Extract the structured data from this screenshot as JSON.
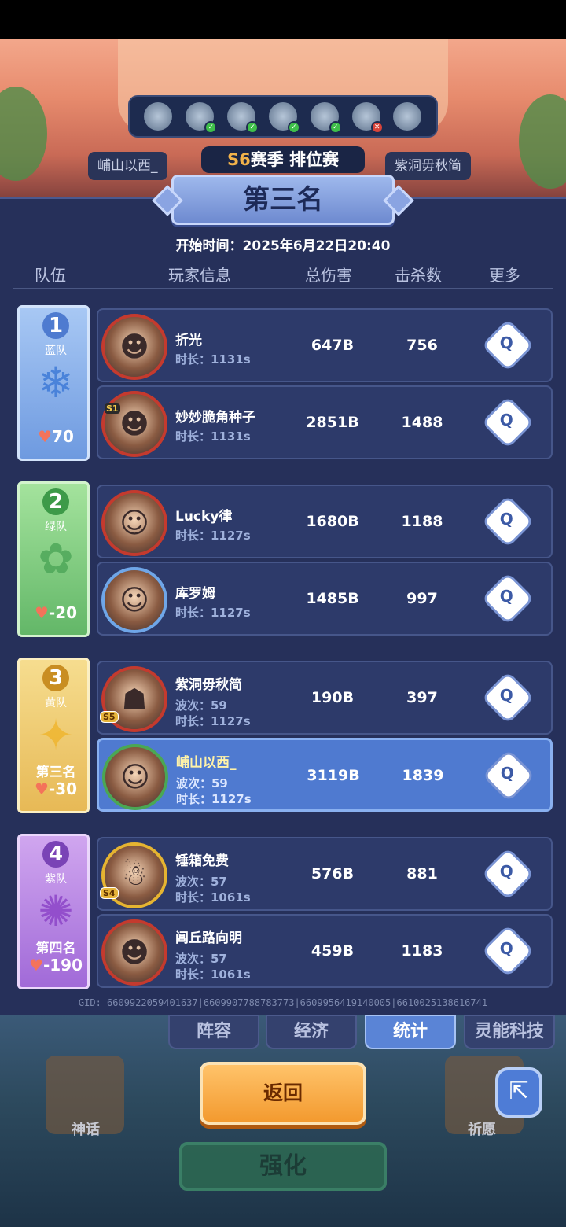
{
  "season": {
    "prefix": "S6",
    "label": "赛季 排位赛"
  },
  "opponents": {
    "left": "峬山以西_",
    "right": "紫洞毋秋简"
  },
  "result_title": "第三名",
  "start_time": "开始时间：2025年6月22日20:40",
  "columns": {
    "team": "队伍",
    "player": "玩家信息",
    "damage": "总伤害",
    "kills": "击杀数",
    "more": "更多"
  },
  "teams": [
    {
      "number": "1",
      "name": "蓝队",
      "rank_label": "",
      "hp": "70",
      "players": [
        {
          "name": "折光",
          "wave": "",
          "duration": "时长：1131s",
          "damage": "647B",
          "kills": "756"
        },
        {
          "name": "妙妙脆角种子",
          "wave": "",
          "duration": "时长：1131s",
          "damage": "2851B",
          "kills": "1488"
        }
      ]
    },
    {
      "number": "2",
      "name": "绿队",
      "rank_label": "",
      "hp": "-20",
      "players": [
        {
          "name": "Lucky律",
          "wave": "",
          "duration": "时长：1127s",
          "damage": "1680B",
          "kills": "1188"
        },
        {
          "name": "库罗姆",
          "wave": "",
          "duration": "时长：1127s",
          "damage": "1485B",
          "kills": "997"
        }
      ]
    },
    {
      "number": "3",
      "name": "黄队",
      "rank_label": "第三名",
      "hp": "-30",
      "players": [
        {
          "name": "紫洞毋秋简",
          "wave": "波次：59",
          "duration": "时长：1127s",
          "damage": "190B",
          "kills": "397"
        },
        {
          "name": "峬山以西_",
          "wave": "波次：59",
          "duration": "时长：1127s",
          "damage": "3119B",
          "kills": "1839"
        }
      ]
    },
    {
      "number": "4",
      "name": "紫队",
      "rank_label": "第四名",
      "hp": "-190",
      "players": [
        {
          "name": "锤箱免费",
          "wave": "波次：57",
          "duration": "时长：1061s",
          "damage": "576B",
          "kills": "881"
        },
        {
          "name": "阊丘路向明",
          "wave": "波次：57",
          "duration": "时长：1061s",
          "damage": "459B",
          "kills": "1183"
        }
      ]
    }
  ],
  "gid": "GID: 6609922059401637|6609907788783773|6609956419140005|6610025138616741",
  "tabs": [
    "阵容",
    "经济",
    "统计",
    "灵能科技"
  ],
  "active_tab": "统计",
  "buttons": {
    "return": "返回",
    "boost": "强化",
    "myth": "神话",
    "wish": "祈愿"
  },
  "colors": {
    "panel": "#26305a",
    "highlight_row": "#4f7ad0",
    "return_button": "#f39a2f",
    "season_accent": "#f2b24a"
  }
}
